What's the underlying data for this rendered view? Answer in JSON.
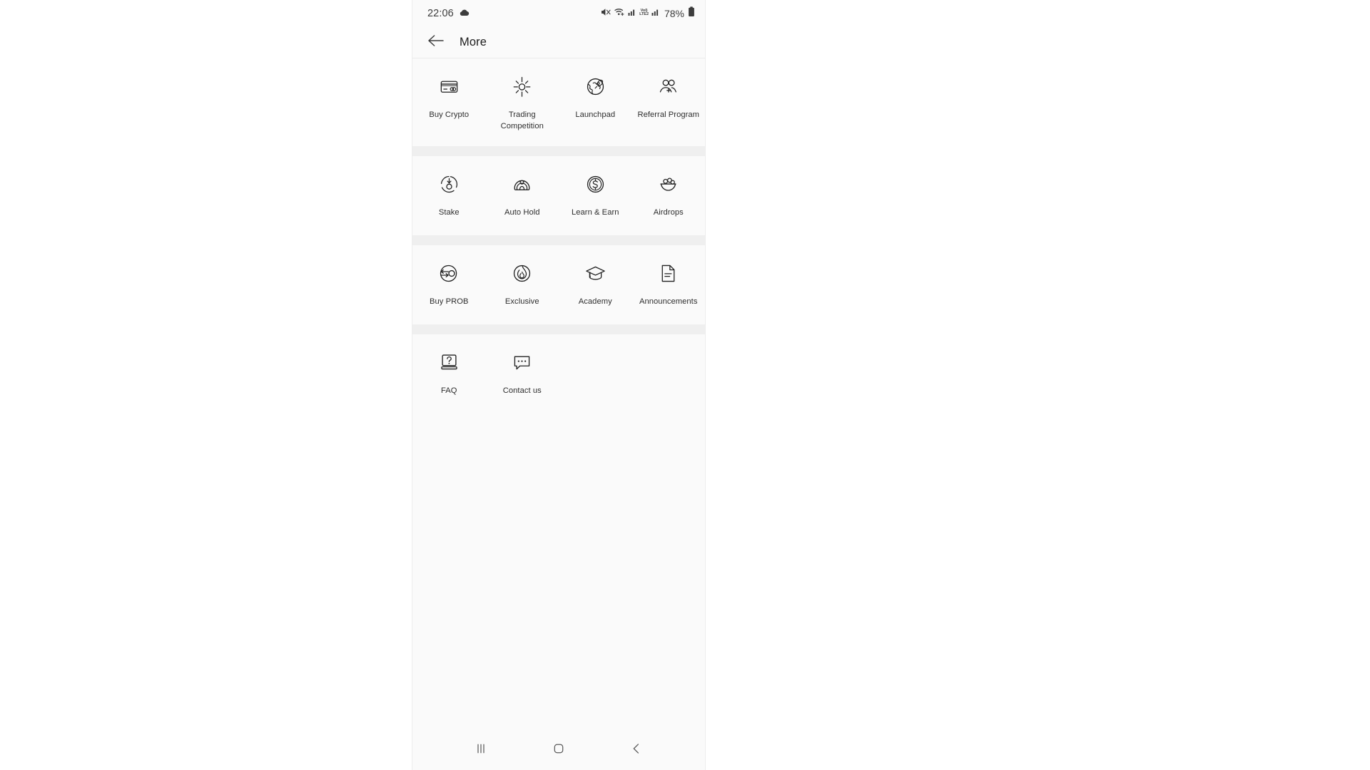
{
  "status_bar": {
    "time": "22:06",
    "weather_icon": "cloud-icon",
    "icons": [
      {
        "name": "mute-icon",
        "label": "Mute"
      },
      {
        "name": "wifi-icon",
        "label": "Wi-Fi"
      },
      {
        "name": "signal-bars-icon",
        "label": "Signal"
      },
      {
        "name": "volte-icon",
        "label": "VoLTE 2"
      },
      {
        "name": "signal-bars-2-icon",
        "label": "Signal 2"
      }
    ],
    "volte_top": "Vol)",
    "volte_bottom": "LTE2",
    "battery_percent": "78%",
    "battery_icon": "battery-full-icon"
  },
  "header": {
    "back_icon": "arrow-left-icon",
    "title": "More"
  },
  "sections": [
    {
      "id": "section-1",
      "items": [
        {
          "label": "Buy Crypto",
          "icon": "credit-card-icon",
          "name": "buy-crypto"
        },
        {
          "label": "Trading\nCompetition",
          "label_line1": "Trading",
          "label_line2": "Competition",
          "icon": "sun-burst-icon",
          "name": "trading-competition"
        },
        {
          "label": "Launchpad",
          "icon": "globe-rocket-icon",
          "name": "launchpad"
        },
        {
          "label": "Referral Program",
          "icon": "people-add-icon",
          "name": "referral-program"
        }
      ]
    },
    {
      "id": "section-2",
      "items": [
        {
          "label": "Stake",
          "icon": "stake-circle-arrow-icon",
          "name": "stake"
        },
        {
          "label": "Auto Hold",
          "icon": "auto-hold-person-icon",
          "name": "auto-hold"
        },
        {
          "label": "Learn & Earn",
          "icon": "dollar-coin-icon",
          "name": "learn-and-earn"
        },
        {
          "label": "Airdrops",
          "icon": "airdrop-bowl-icon",
          "name": "airdrops"
        }
      ]
    },
    {
      "id": "section-3",
      "items": [
        {
          "label": "Buy PROB",
          "icon": "swap-circle-icon",
          "name": "buy-prob"
        },
        {
          "label": "Exclusive",
          "icon": "flame-circle-icon",
          "name": "exclusive"
        },
        {
          "label": "Academy",
          "icon": "graduation-cap-icon",
          "name": "academy"
        },
        {
          "label": "Announcements",
          "icon": "document-icon",
          "name": "announcements"
        }
      ]
    },
    {
      "id": "section-4",
      "items": [
        {
          "label": "FAQ",
          "icon": "faq-book-icon",
          "name": "faq"
        },
        {
          "label": "Contact us",
          "icon": "chat-bubble-icon",
          "name": "contact-us"
        }
      ]
    }
  ],
  "nav_bar": {
    "recents_label": "Recents",
    "home_label": "Home",
    "back_label": "Back"
  },
  "colors": {
    "background": "#fafafa",
    "divider": "#efefef",
    "text": "#2e2e2e",
    "icon_stroke": "#222222"
  }
}
